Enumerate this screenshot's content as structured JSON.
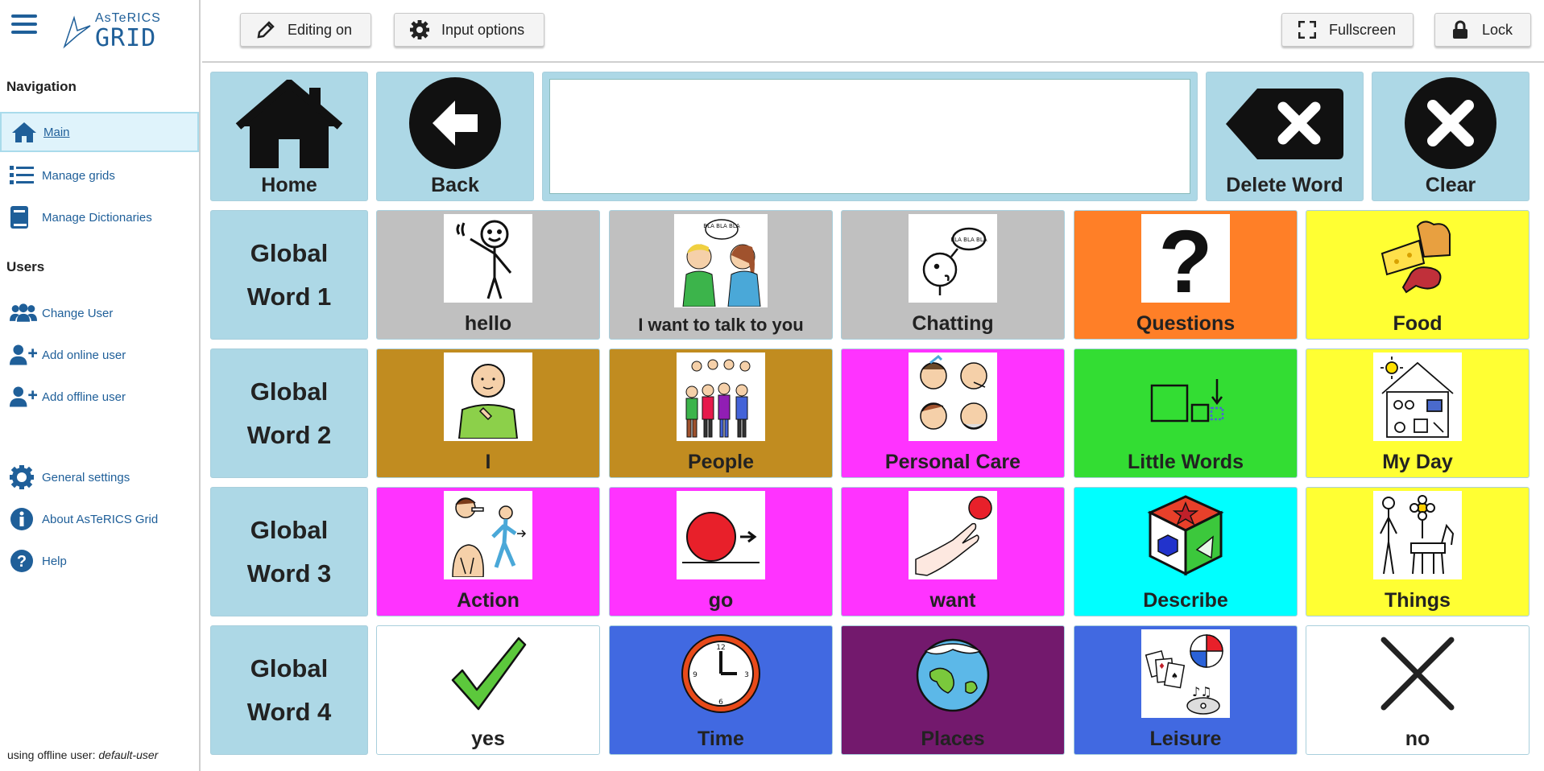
{
  "app": {
    "logo_top": "AsTeRICS",
    "logo_bottom": "GRID"
  },
  "sidebar": {
    "navigation_heading": "Navigation",
    "users_heading": "Users",
    "items": [
      {
        "label": "Main",
        "icon": "home-icon"
      },
      {
        "label": "Manage grids",
        "icon": "list-icon"
      },
      {
        "label": "Manage Dictionaries",
        "icon": "book-icon"
      },
      {
        "label": "Change User",
        "icon": "users-icon"
      },
      {
        "label": "Add online user",
        "icon": "user-plus-icon"
      },
      {
        "label": "Add offline user",
        "icon": "user-plus-icon"
      },
      {
        "label": "General settings",
        "icon": "gear-icon"
      },
      {
        "label": "About AsTeRICS Grid",
        "icon": "info-icon"
      },
      {
        "label": "Help",
        "icon": "question-icon"
      }
    ],
    "status_prefix": "using offline user:",
    "status_user": "default-user"
  },
  "toolbar": {
    "editing": "Editing on",
    "input_options": "Input options",
    "fullscreen": "Fullscreen",
    "lock": "Lock"
  },
  "colors": {
    "light_blue": "#add8e6",
    "gray": "#c0c0c0",
    "orange": "#ff7f27",
    "yellow": "#ffff33",
    "brown": "#c18c20",
    "magenta": "#ff33ff",
    "green": "#33dd33",
    "cyan": "#00ffff",
    "blue": "#4169e1",
    "purple": "#73196d",
    "white": "#ffffff"
  },
  "grid": {
    "top_row": {
      "home": "Home",
      "back": "Back",
      "delete_word": "Delete Word",
      "clear": "Clear"
    },
    "global_words": [
      {
        "line1": "Global",
        "line2": "Word 1"
      },
      {
        "line1": "Global",
        "line2": "Word 2"
      },
      {
        "line1": "Global",
        "line2": "Word 3"
      },
      {
        "line1": "Global",
        "line2": "Word 4"
      }
    ],
    "rows": [
      [
        "hello",
        "I want to talk to you",
        "Chatting",
        "Questions",
        "Food"
      ],
      [
        "I",
        "People",
        "Personal Care",
        "Little Words",
        "My Day"
      ],
      [
        "Action",
        "go",
        "want",
        "Describe",
        "Things"
      ],
      [
        "yes",
        "Time",
        "Places",
        "Leisure",
        "no"
      ]
    ],
    "speech_bubble_text": "BLA BLA BLA"
  }
}
